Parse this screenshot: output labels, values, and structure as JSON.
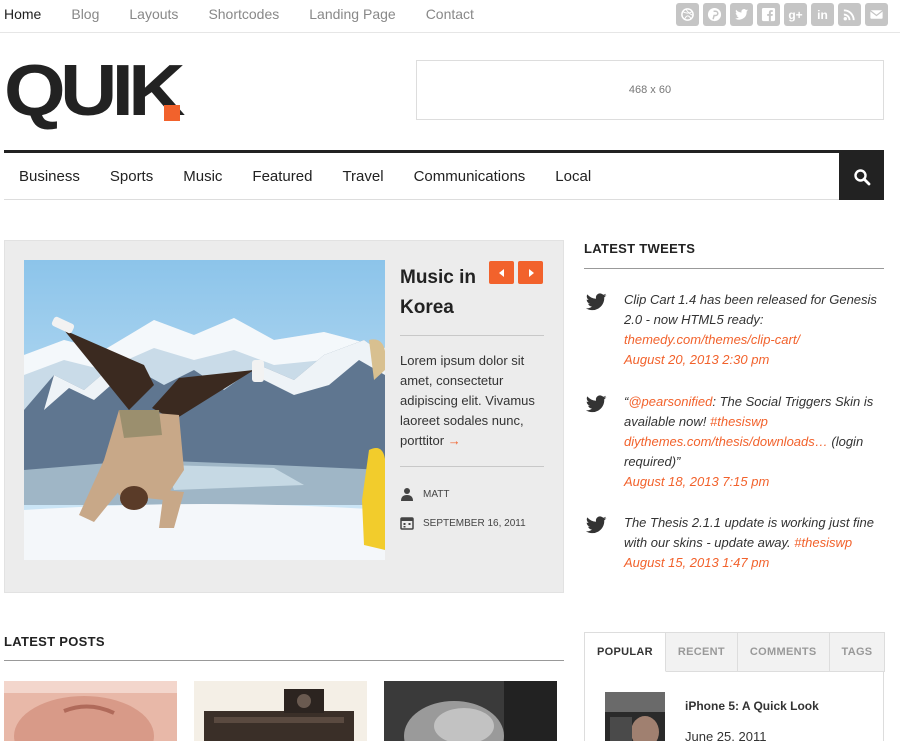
{
  "topnav": {
    "items": [
      "Home",
      "Blog",
      "Layouts",
      "Shortcodes",
      "Landing Page",
      "Contact"
    ],
    "active": "Home"
  },
  "social_icons": [
    "dribbble-icon",
    "pinterest-icon",
    "twitter-icon",
    "facebook-icon",
    "google-plus-icon",
    "linkedin-icon",
    "rss-icon",
    "email-icon"
  ],
  "header": {
    "logo": "QUIK",
    "ad_label": "468 x 60"
  },
  "mainnav": {
    "items": [
      "Business",
      "Sports",
      "Music",
      "Featured",
      "Travel",
      "Communications",
      "Local"
    ]
  },
  "featured": {
    "title_line1": "Music in",
    "title_line2": "Korea",
    "excerpt": "Lorem ipsum dolor sit amet, consectetur adipiscing elit. Vivamus laoreet sodales nunc, porttitor",
    "more_arrow": "→",
    "author": "MATT",
    "date": "SEPTEMBER 16, 2011"
  },
  "latest_posts": {
    "title": "LATEST POSTS"
  },
  "tweets": {
    "title": "LATEST TWEETS",
    "items": [
      {
        "text": "Clip Cart 1.4 has been released for Genesis 2.0 - now HTML5 ready: ",
        "link": "themedy.com/themes/clip-cart/",
        "date": "August 20, 2013 2:30 pm"
      },
      {
        "quote_open": "“",
        "mention": "@pearsonified",
        "text": ": The Social Triggers Skin is available now! ",
        "hashtag": "#thesiswp",
        "link": "diythemes.com/thesis/downloads…",
        "tail": " (login required)”",
        "date": "August 18, 2013 7:15 pm"
      },
      {
        "text": "The Thesis 2.1.1 update is working just fine with our skins - update away. ",
        "hashtag": "#thesiswp",
        "date": "August 15, 2013 1:47 pm"
      }
    ]
  },
  "tabs_widget": {
    "tabs": [
      "POPULAR",
      "RECENT",
      "COMMENTS",
      "TAGS"
    ],
    "active": "POPULAR",
    "post_title": "iPhone 5: A Quick Look",
    "post_date": "June 25, 2011"
  },
  "colors": {
    "accent": "#f2622c",
    "dark": "#222222",
    "panel_bg": "#ececec"
  }
}
